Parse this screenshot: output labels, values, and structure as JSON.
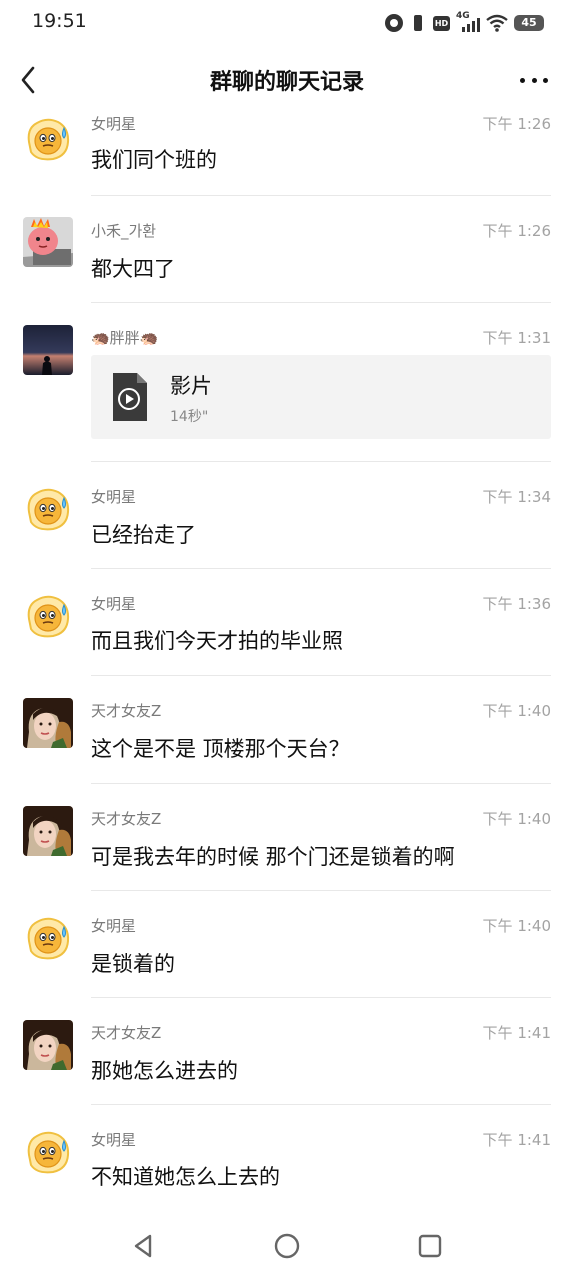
{
  "status_bar": {
    "time": "19:51",
    "battery": "45",
    "network": "4G",
    "hd": "HD",
    "icons": [
      "alarm-icon",
      "vibrate-icon",
      "hd-icon",
      "signal-4g-icon",
      "wifi-icon",
      "battery-icon"
    ]
  },
  "header": {
    "title": "群聊的聊天记录",
    "back_icon": "chevron-left-icon",
    "more_icon": "more-dots-icon"
  },
  "messages": [
    {
      "sender": "女明星",
      "time": "下午 1:26",
      "text": "我们同个班的",
      "avatar": "emoji-sweat"
    },
    {
      "sender": "小禾_가환",
      "time": "下午 1:26",
      "text": "都大四了",
      "avatar": "pink-monster"
    },
    {
      "sender": "🦔胖胖🦔",
      "time": "下午 1:31",
      "type": "video",
      "video": {
        "title": "影片",
        "duration": "14秒\""
      },
      "avatar": "dusk-silhouette"
    },
    {
      "sender": "女明星",
      "time": "下午 1:34",
      "text": "已经抬走了",
      "avatar": "emoji-sweat"
    },
    {
      "sender": "女明星",
      "time": "下午 1:36",
      "text": "而且我们今天才拍的毕业照",
      "avatar": "emoji-sweat"
    },
    {
      "sender": "天才女友Z",
      "time": "下午 1:40",
      "text": "这个是不是 顶楼那个天台？",
      "avatar": "girl-portrait"
    },
    {
      "sender": "天才女友Z",
      "time": "下午 1:40",
      "text": "可是我去年的时候 那个门还是锁着的啊",
      "avatar": "girl-portrait"
    },
    {
      "sender": "女明星",
      "time": "下午 1:40",
      "text": "是锁着的",
      "avatar": "emoji-sweat"
    },
    {
      "sender": "天才女友Z",
      "time": "下午 1:41",
      "text": "那她怎么进去的",
      "avatar": "girl-portrait"
    },
    {
      "sender": "女明星",
      "time": "下午 1:41",
      "text": "不知道她怎么上去的",
      "avatar": "emoji-sweat"
    }
  ],
  "nav_bar": {
    "icons": [
      "nav-back-icon",
      "nav-home-icon",
      "nav-recents-icon"
    ]
  }
}
